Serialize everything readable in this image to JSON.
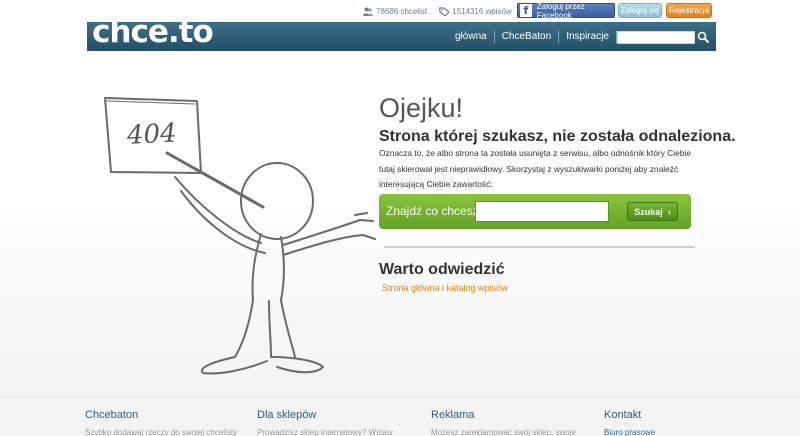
{
  "stats": {
    "chcelist_count": "78686 chcelist",
    "entries_count": "1514316 wpisów"
  },
  "auth": {
    "facebook_label": "Zaloguj przez Facebook",
    "facebook_glyph": "f",
    "login_label": "Zaloguj się",
    "register_label": "Rejestracja"
  },
  "logo": {
    "text": "chce.to"
  },
  "nav": {
    "items": [
      {
        "label": "główna"
      },
      {
        "label": "ChceBaton"
      },
      {
        "label": "Inspiracje"
      }
    ]
  },
  "header_search": {
    "value": "",
    "placeholder": ""
  },
  "illustration": {
    "sign_text": "404"
  },
  "main": {
    "title": "Ojejku!",
    "subtitle": "Strona której szukasz, nie została odnaleziona.",
    "description": "Oznacza to, że albo strona ta została usunięta z serwisu, albo odnośnik który Ciebie tutaj skierował jest nieprawidłowy. Skorzystaj z wyszukiwarki poniżej aby znaleźć interesującą Ciebie zawartość:",
    "search_label": "Znajdź co chcesz",
    "search_value": "",
    "search_button": "Szukaj",
    "search_button_arrow": "›",
    "worth_title": "Warto odwiedzić",
    "worth_link": "Strona główna i katalog wpisów"
  },
  "footer": {
    "columns": [
      {
        "heading": "Chcebaton",
        "text": "Szybko dodawaj rzeczy do swojej chcelisty"
      },
      {
        "heading": "Dla sklepów",
        "text": "Prowadzisz sklep internetowy? Wstaw"
      },
      {
        "heading": "Reklama",
        "text": "Możesz zareklamować swój sklep, swoje"
      },
      {
        "heading": "Kontakt",
        "link": "Biuro prasowe"
      }
    ]
  },
  "colors": {
    "header": "#2f5f77",
    "accent_orange": "#e9801c",
    "search_green": "#74b436",
    "facebook_blue": "#3b5998"
  }
}
